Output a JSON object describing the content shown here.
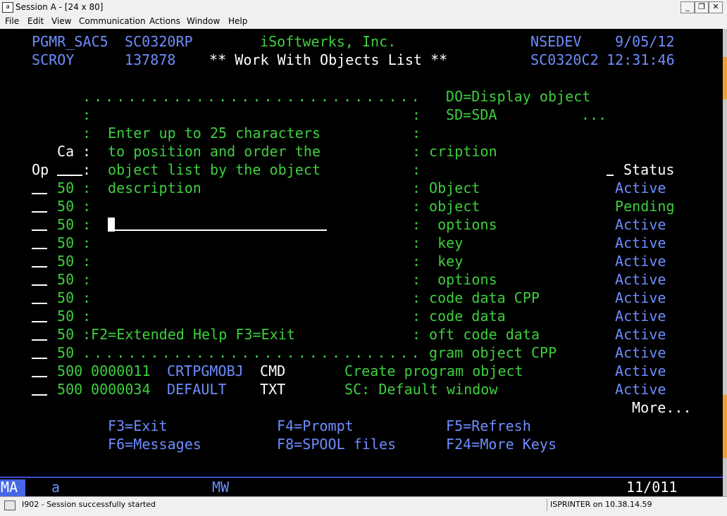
{
  "window": {
    "title": "Session A - [24 x 80]",
    "icon_label": "a",
    "buttons": {
      "minimize": "_",
      "restore": "❐",
      "close": "✕"
    }
  },
  "menu": [
    "File",
    "Edit",
    "View",
    "Communication",
    "Actions",
    "Window",
    "Help"
  ],
  "header": {
    "user_program": "PGMR_SAC5",
    "program": "SC0320RP",
    "company": "iSoftwerks, Inc.",
    "system": "NSEDEV",
    "date": "9/05/12",
    "user": "SCROY",
    "job_number": "137878",
    "screen_title": "** Work With Objects List **",
    "format": "SC0320C2",
    "time": "12:31:46"
  },
  "options_legend": {
    "do": "DO=Display object",
    "sd": "SD=SDA",
    "more_dots": "..."
  },
  "popup": {
    "top_border": "..............................",
    "bottom_border": "..............................",
    "side": ":",
    "instructions": [
      "Enter up to 25 characters",
      "to position and order the",
      "object list by the object",
      "description"
    ],
    "function_keys": "F2=Extended Help F3=Exit"
  },
  "columns": {
    "op": "Op",
    "ca": "Ca",
    "description_fragment": "cription",
    "status": "Status"
  },
  "rows": [
    {
      "num": "50",
      "desc": "Object",
      "status": "Active"
    },
    {
      "num": "50",
      "desc": "object",
      "status": "Pending"
    },
    {
      "num": "50",
      "desc": " options",
      "status": "Active"
    },
    {
      "num": "50",
      "desc": " key",
      "status": "Active"
    },
    {
      "num": "50",
      "desc": " key",
      "status": "Active"
    },
    {
      "num": "50",
      "desc": " options",
      "status": "Active"
    },
    {
      "num": "50",
      "desc": "code data CPP",
      "status": "Active"
    },
    {
      "num": "50",
      "desc": "code data",
      "status": "Active"
    },
    {
      "num": "50",
      "desc": "oft code data",
      "status": "Active"
    },
    {
      "num": "50",
      "desc": "gram object CPP",
      "status": "Active"
    }
  ],
  "full_rows": [
    {
      "num": "500",
      "seq": "0000011",
      "object": "CRTPGMOBJ",
      "type": "CMD",
      "description": "Create program object",
      "status": "Active"
    },
    {
      "num": "500",
      "seq": "0000034",
      "object": "DEFAULT",
      "type": "TXT",
      "description": "SC: Default window",
      "status": "Active"
    }
  ],
  "more": "More...",
  "function_keys": {
    "f3": "F3=Exit",
    "f4": "F4=Prompt",
    "f5": "F5=Refresh",
    "f6": "F6=Messages",
    "f8": "F8=SPOOL files",
    "f24": "F24=More Keys"
  },
  "oia": {
    "ma": "MA",
    "a": "a",
    "mw": "MW",
    "cursor_pos": "11/011"
  },
  "statusbar": {
    "message": "I902 - Session successfully started",
    "printer": "ISPRINTER on 10.38.14.59"
  },
  "colors": {
    "terminal_bg": "#000000",
    "green": "#3ecf3e",
    "blue": "#6e8dff",
    "white": "#ffffff",
    "oia_accent": "#4766e6"
  }
}
